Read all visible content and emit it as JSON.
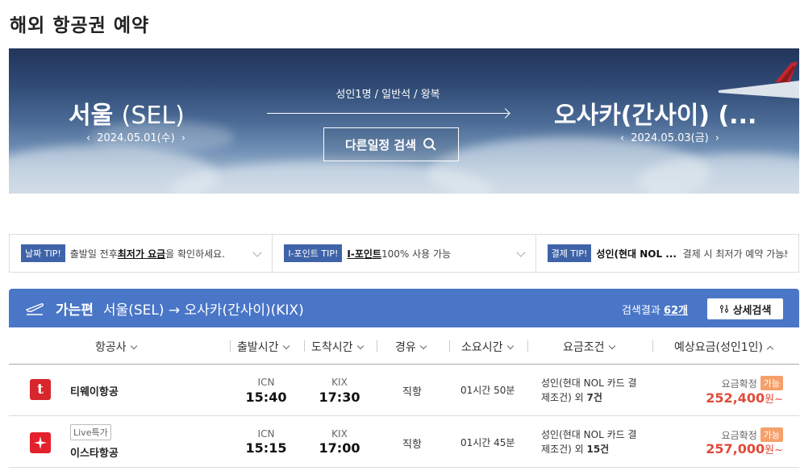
{
  "page_title": "해외 항공권 예약",
  "hero": {
    "origin_city": "서울",
    "origin_code": "(SEL)",
    "origin_date": "2024.05.01(수)",
    "dest_city": "오사카(간사이) (...",
    "dest_date": "2024.05.03(금)",
    "trip_info": "성인1명 / 일반석 / 왕복",
    "other_search_label": "다른일정 검색"
  },
  "tips": [
    {
      "badge": "날짜 TIP!",
      "pre": "출발일 전후 ",
      "bold": "최저가 요금",
      "post": "을 확인하세요."
    },
    {
      "badge": "I-포인트 TIP!",
      "pre": "",
      "bold": "I-포인트",
      "post": " 100% 사용 가능"
    },
    {
      "badge": "결제 TIP!",
      "pre": "",
      "bold": "성인(현대 NOL ...",
      "post": "  결제 시 최저가 예약 가능!"
    }
  ],
  "results_bar": {
    "direction": "가는편",
    "route": "서울(SEL) → 오사카(간사이)(KIX)",
    "count_label": "검색결과",
    "count": "62개",
    "detail_button": "상세검색"
  },
  "columns": [
    "항공사",
    "출발시간",
    "도착시간",
    "경유",
    "소요시간",
    "요금조건",
    "예상요금(성인1인)"
  ],
  "flights": [
    {
      "airline": "티웨이항공",
      "live_badge": "",
      "dep_airport": "ICN",
      "dep_time": "15:40",
      "arr_airport": "KIX",
      "arr_time": "17:30",
      "stops": "직항",
      "duration": "01시간 50분",
      "cond_line1": "성인(현대 NOL 카드 결",
      "cond_line2": "제조건) 외 ",
      "cond_count": "7건",
      "fare_status": "요금확정",
      "fare_ok": "가능",
      "price": "252,400",
      "price_unit": "원~",
      "logo_color": "#d7262c"
    },
    {
      "airline": "이스타항공",
      "live_badge": "Live특가",
      "dep_airport": "ICN",
      "dep_time": "15:15",
      "arr_airport": "KIX",
      "arr_time": "17:00",
      "stops": "직항",
      "duration": "01시간 45분",
      "cond_line1": "성인(현대 NOL 카드 결",
      "cond_line2": "제조건) 외 ",
      "cond_count": "15건",
      "fare_status": "요금확정",
      "fare_ok": "가능",
      "price": "257,000",
      "price_unit": "원~",
      "logo_color": "#e3202b"
    }
  ]
}
